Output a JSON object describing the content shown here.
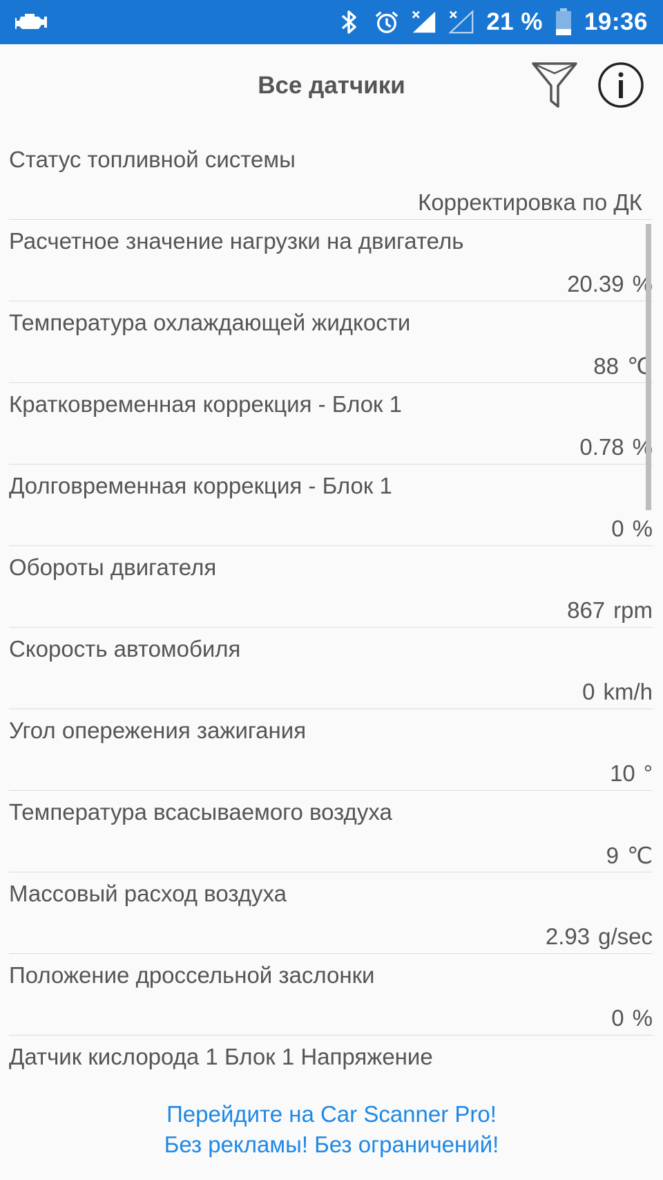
{
  "status_bar": {
    "battery_percent": "21 %",
    "time": "19:36",
    "icons": [
      "engine-icon",
      "bluetooth-icon",
      "alarm-icon",
      "signal-icon",
      "signal-no-sim-icon",
      "battery-icon"
    ],
    "color": "#1976d2"
  },
  "header": {
    "title": "Все датчики",
    "icons": [
      "filter-icon",
      "info-icon"
    ]
  },
  "sensors": [
    {
      "name": "Статус топливной системы",
      "value": "Корректировка по ДК",
      "unit": ""
    },
    {
      "name": "Расчетное значение нагрузки на двигатель",
      "value": "20.39",
      "unit": "%"
    },
    {
      "name": "Температура охлаждающей жидкости",
      "value": "88",
      "unit": "℃"
    },
    {
      "name": "Кратковременная коррекция - Блок 1",
      "value": "0.78",
      "unit": "%"
    },
    {
      "name": "Долговременная коррекция - Блок 1",
      "value": "0",
      "unit": "%"
    },
    {
      "name": "Обороты двигателя",
      "value": "867",
      "unit": "rpm"
    },
    {
      "name": "Скорость автомобиля",
      "value": "0",
      "unit": "km/h"
    },
    {
      "name": "Угол опережения зажигания",
      "value": "10",
      "unit": "°"
    },
    {
      "name": "Температура всасываемого воздуха",
      "value": "9",
      "unit": "℃"
    },
    {
      "name": "Массовый расход воздуха",
      "value": "2.93",
      "unit": "g/sec"
    },
    {
      "name": "Положение дроссельной заслонки",
      "value": "0",
      "unit": "%"
    },
    {
      "name": "Датчик кислорода 1 Блок 1 Напряжение",
      "value": "",
      "unit": ""
    }
  ],
  "promo": {
    "line1": "Перейдите на Car Scanner Pro!",
    "line2": "Без рекламы! Без ограничений!",
    "color": "#1e88e5"
  }
}
